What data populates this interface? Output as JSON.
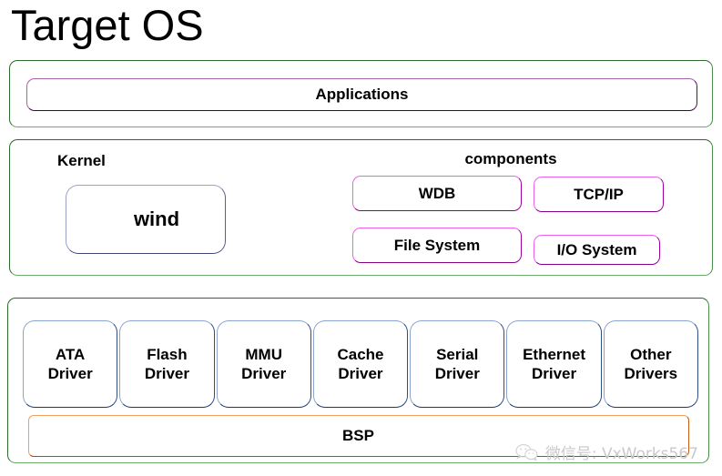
{
  "page": {
    "title": "Target OS"
  },
  "applications": {
    "label": "Applications"
  },
  "kernel": {
    "label": "Kernel",
    "core": {
      "label": "wind"
    },
    "components": {
      "label": "components",
      "items": [
        {
          "label": "WDB"
        },
        {
          "label": "TCP/IP"
        },
        {
          "label": "File System"
        },
        {
          "label": "I/O System"
        }
      ]
    }
  },
  "bsp": {
    "label": "BSP",
    "drivers": [
      {
        "line1": "ATA",
        "line2": "Driver"
      },
      {
        "line1": "Flash",
        "line2": "Driver"
      },
      {
        "line1": "MMU",
        "line2": "Driver"
      },
      {
        "line1": "Cache",
        "line2": "Driver"
      },
      {
        "line1": "Serial",
        "line2": "Driver"
      },
      {
        "line1": "Ethernet",
        "line2": "Driver"
      },
      {
        "line1": "Other",
        "line2": "Drivers"
      }
    ]
  },
  "watermark": {
    "icon": "wechat-icon",
    "text": "微信号: VxWorks567"
  },
  "colors": {
    "container_border": "#2d6a2d",
    "applications_border": "#a663a6",
    "component_border": "#ee5fee",
    "driver_border": "#1f3864",
    "bsp_border": "#c65a10",
    "watermark_text": "#c9c9c9"
  }
}
